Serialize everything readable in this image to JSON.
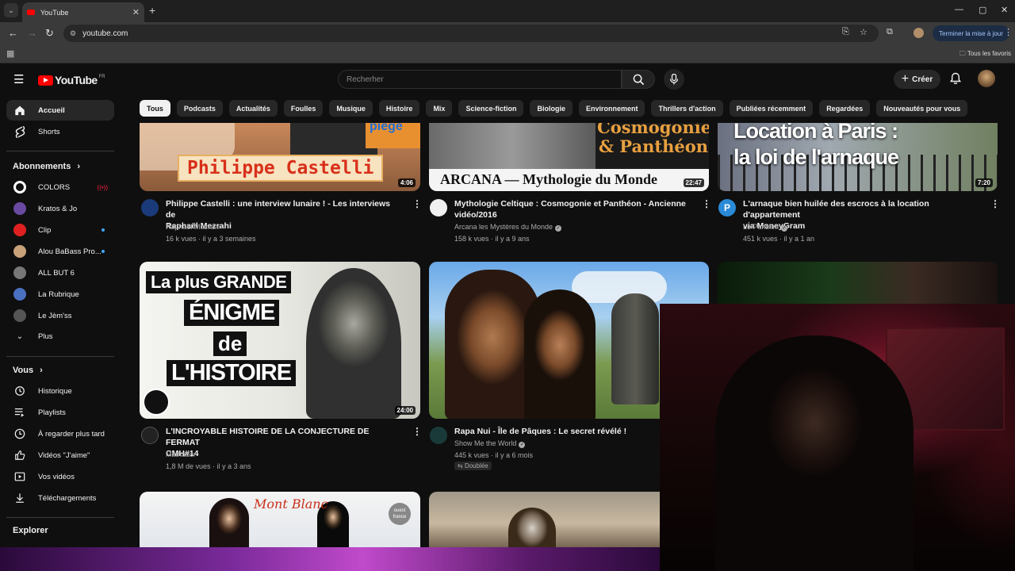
{
  "browser": {
    "tab_title": "YouTube",
    "url": "youtube.com",
    "update_button": "Terminer la mise à jour",
    "bookmarks_all": "Tous les favoris"
  },
  "header": {
    "logo_text": "YouTube",
    "logo_country": "FR",
    "search_placeholder": "Recherher",
    "create_label": "Créer"
  },
  "chips": [
    "Tous",
    "Podcasts",
    "Actualités",
    "Foulles",
    "Musique",
    "Histoire",
    "Mix",
    "Science-fiction",
    "Biologie",
    "Environnement",
    "Thrillers d'action",
    "Publiées récemment",
    "Regardées",
    "Nouveautés pour vous"
  ],
  "sidebar": {
    "home": "Accueil",
    "shorts": "Shorts",
    "subscriptions_title": "Abonnements",
    "subscriptions": [
      {
        "name": "COLORS",
        "color": "#ffffff",
        "live": true
      },
      {
        "name": "Kratos & Jo",
        "color": "#6a4aa0",
        "live": false
      },
      {
        "name": "Clip",
        "color": "#e02020",
        "live": false,
        "dot": true
      },
      {
        "name": "Alou BaBass Pro...",
        "color": "#c9a27a",
        "live": false,
        "dot": true
      },
      {
        "name": "ALL BUT 6",
        "color": "#777777",
        "live": false
      },
      {
        "name": "La Rubrique",
        "color": "#4a70c0",
        "live": false
      },
      {
        "name": "Le Jèm'ss",
        "color": "#555555",
        "live": false
      }
    ],
    "more": "Plus",
    "you_title": "Vous",
    "you_items": [
      "Historique",
      "Playlists",
      "À regarder plus tard",
      "Vidéos \"J'aime\"",
      "Vos vidéos",
      "Téléchargements"
    ],
    "explore_title": "Explorer"
  },
  "videos_row1": [
    {
      "thumb_text": "Philippe Castelli",
      "thumb_sub": "piège",
      "duration": "4:06",
      "title_line1": "Philippe Castelli : une interview lunaire ! - Les interviews de",
      "title_line2": "Raphaël Mezrahi",
      "channel": "Raphaël Mezrahi",
      "meta": "16 k vues · il y a 3 semaines"
    },
    {
      "thumb_text": "ARCANA — Mythologie du Monde",
      "thumb_sub": "Cosmogonie & Panthéon",
      "duration": "22:47",
      "title_line1": "Mythologie Celtique : Cosmogonie et Panthéon - Ancienne",
      "title_line2": "vidéo/2016",
      "channel": "Arcana les Mystères du Monde",
      "meta": "158 k vues · il y a 9 ans"
    },
    {
      "thumb_text": "Location à Paris :",
      "thumb_sub": "la loi de l'arnaque",
      "duration": "7:20",
      "title_line1": "L'arnaque bien huilée des escrocs à la location d'appartement",
      "title_line2": "via MoneyGram",
      "channel": "Le Parisien",
      "meta": "451 k vues · il y a 1 an"
    }
  ],
  "videos_row2": [
    {
      "thumb_line1": "La plus GRANDE",
      "thumb_line2": "ÉNIGME",
      "thumb_line3": "de",
      "thumb_line4": "L'HISTOIRE",
      "duration": "24:00",
      "title_line1": "L'INCROYABLE HISTOIRE DE LA CONJECTURE DE FERMAT",
      "title_line2": "CMH#14",
      "channel": "Mathador",
      "meta": "1,8 M de vues · il y a 3 ans"
    },
    {
      "title_line1": "Rapa Nui - Île de Pâques : Le secret révélé !",
      "channel": "Show Me the World",
      "meta": "445 k vues · il y a 6 mois",
      "badge": "Doublée"
    }
  ],
  "videos_row3": [
    {
      "thumb_text": "Mont Blanc",
      "thumb_logo": "ouest france"
    }
  ],
  "colors": {
    "accent": "#ff0000",
    "bg": "#0f0f0f",
    "chip": "#272727"
  }
}
